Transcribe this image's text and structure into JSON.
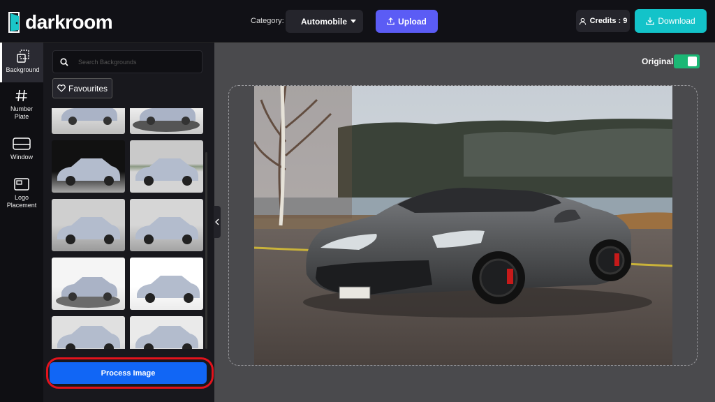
{
  "header": {
    "logo_text": "darkroom",
    "category_label": "Category:",
    "category_value": "Automobile",
    "upload_label": "Upload",
    "credits_label": "Credits : 9",
    "download_label": "Download"
  },
  "rail": {
    "items": [
      {
        "label": "Background",
        "icon": "layers-icon"
      },
      {
        "label": "Number Plate",
        "icon": "hash-icon"
      },
      {
        "label": "Window",
        "icon": "window-icon"
      },
      {
        "label": "Logo Placement",
        "icon": "logo-icon"
      }
    ]
  },
  "panel": {
    "search_placeholder": "Search Backgrounds",
    "favourites_label": "Favourites",
    "process_label": "Process Image"
  },
  "main": {
    "original_label": "Original",
    "original_toggle_on": true
  },
  "colors": {
    "accent_blue": "#1166f5",
    "upload_purple": "#5b5cf5",
    "download_teal": "#13c3c9",
    "toggle_green": "#1bb875",
    "highlight_red": "#e3131c"
  }
}
